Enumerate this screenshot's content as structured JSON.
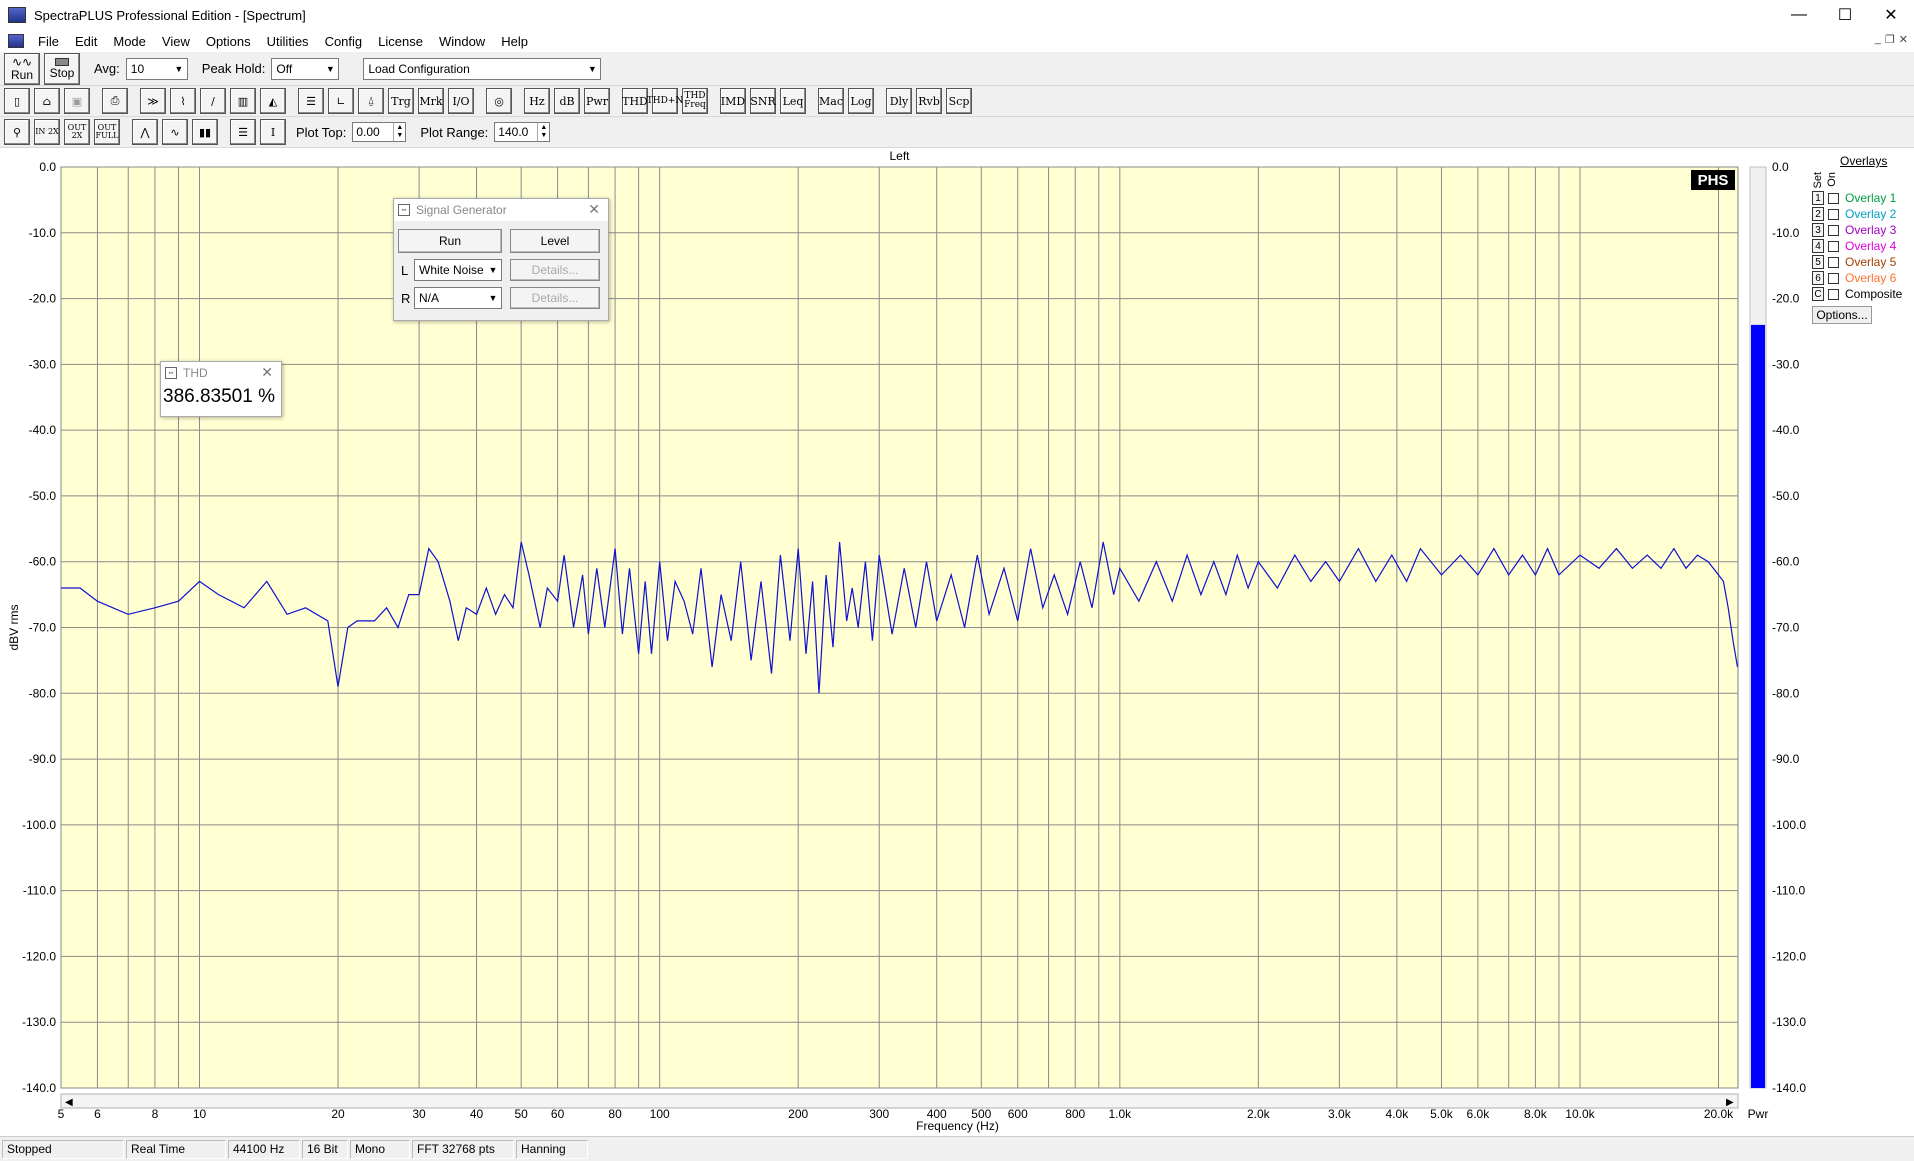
{
  "window": {
    "title": "SpectraPLUS Professional Edition - [Spectrum]",
    "buttons": [
      "—",
      "☐",
      "✕"
    ]
  },
  "menu": {
    "items": [
      "File",
      "Edit",
      "Mode",
      "View",
      "Options",
      "Utilities",
      "Config",
      "License",
      "Window",
      "Help"
    ],
    "mdi_buttons": [
      "_",
      "❐",
      "✕"
    ]
  },
  "toolbar1": {
    "run_label": "Run",
    "stop_label": "Stop",
    "avg_label": "Avg:",
    "avg_value": "10",
    "peak_label": "Peak Hold:",
    "peak_value": "Off",
    "config_value": "Load Configuration"
  },
  "toolbar2": {
    "buttons": [
      "Trg",
      "Mrk",
      "I/O",
      "Hz",
      "dB",
      "Pwr",
      "THD",
      "THD+N",
      "THD Freq",
      "IMD",
      "SNR",
      "Leq",
      "Mac",
      "Log",
      "Dly",
      "Rvb",
      "Scp"
    ]
  },
  "toolbar3": {
    "zoom_buttons": [
      "IN 2X",
      "OUT 2X",
      "OUT FULL"
    ],
    "plot_top_label": "Plot Top:",
    "plot_top_value": "0.00",
    "plot_range_label": "Plot Range:",
    "plot_range_value": "140.0"
  },
  "chart_data": {
    "type": "line",
    "title": "Left",
    "xlabel": "Frequency (Hz)",
    "ylabel": "dBV rms",
    "x_scale": "log",
    "xlim": [
      5,
      22050
    ],
    "ylim": [
      -140,
      0
    ],
    "x_tick_labels": [
      "5",
      "6",
      "8",
      "10",
      "20",
      "30",
      "40",
      "50",
      "60",
      "80",
      "100",
      "200",
      "300",
      "400",
      "500",
      "600",
      "800",
      "1.0k",
      "2.0k",
      "3.0k",
      "4.0k",
      "5.0k",
      "6.0k",
      "8.0k",
      "10.0k",
      "20.0k"
    ],
    "x_tick_values": [
      5,
      6,
      8,
      10,
      20,
      30,
      40,
      50,
      60,
      80,
      100,
      200,
      300,
      400,
      500,
      600,
      800,
      1000,
      2000,
      3000,
      4000,
      5000,
      6000,
      8000,
      10000,
      20000
    ],
    "y_tick_labels": [
      "0.0",
      "-10.0",
      "-20.0",
      "-30.0",
      "-40.0",
      "-50.0",
      "-60.0",
      "-70.0",
      "-80.0",
      "-90.0",
      "-100.0",
      "-110.0",
      "-120.0",
      "-130.0",
      "-140.0"
    ],
    "grid": true,
    "series": [
      {
        "color": "#1010d0",
        "x": [
          5,
          5.5,
          6,
          7,
          8,
          9,
          10,
          11,
          12.5,
          14,
          15.5,
          17,
          19,
          20,
          21,
          22,
          24,
          25.5,
          27,
          28.5,
          30,
          31.5,
          33,
          35,
          36.5,
          38,
          40,
          42,
          44,
          46,
          48,
          50,
          52,
          55,
          57,
          60,
          62,
          65,
          68,
          70,
          73,
          76,
          80,
          83,
          86,
          90,
          93,
          96,
          100,
          104,
          108,
          113,
          118,
          123,
          130,
          136,
          143,
          150,
          158,
          166,
          175,
          183,
          192,
          200,
          208,
          215,
          222,
          230,
          238,
          246,
          255,
          262,
          270,
          280,
          290,
          300,
          320,
          340,
          360,
          380,
          400,
          430,
          460,
          490,
          520,
          560,
          600,
          640,
          680,
          720,
          770,
          820,
          870,
          920,
          970,
          1000,
          1100,
          1200,
          1300,
          1400,
          1500,
          1600,
          1700,
          1800,
          1900,
          2000,
          2200,
          2400,
          2600,
          2800,
          3000,
          3300,
          3600,
          3900,
          4200,
          4500,
          5000,
          5500,
          6000,
          6500,
          7000,
          7500,
          8000,
          8500,
          9000,
          10000,
          11000,
          12000,
          13000,
          14000,
          15000,
          16000,
          17000,
          18000,
          19000,
          20000,
          20500,
          21000,
          21500,
          22000
        ],
        "y": [
          -64,
          -64,
          -66,
          -68,
          -67,
          -66,
          -63,
          -65,
          -67,
          -63,
          -68,
          -67,
          -69,
          -79,
          -70,
          -69,
          -69,
          -67,
          -70,
          -65,
          -65,
          -58,
          -60,
          -66,
          -72,
          -67,
          -68,
          -64,
          -68,
          -65,
          -67,
          -57,
          -62,
          -70,
          -64,
          -66,
          -59,
          -70,
          -62,
          -71,
          -61,
          -70,
          -58,
          -71,
          -61,
          -74,
          -63,
          -74,
          -60,
          -72,
          -63,
          -66,
          -71,
          -61,
          -76,
          -65,
          -72,
          -60,
          -75,
          -63,
          -77,
          -59,
          -72,
          -58,
          -74,
          -63,
          -80,
          -62,
          -73,
          -57,
          -69,
          -64,
          -70,
          -60,
          -72,
          -59,
          -71,
          -61,
          -70,
          -60,
          -69,
          -62,
          -70,
          -59,
          -68,
          -61,
          -69,
          -58,
          -67,
          -62,
          -68,
          -60,
          -67,
          -57,
          -65,
          -61,
          -66,
          -60,
          -66,
          -59,
          -65,
          -60,
          -65,
          -59,
          -64,
          -60,
          -64,
          -59,
          -63,
          -60,
          -63,
          -58,
          -63,
          -59,
          -63,
          -58,
          -62,
          -59,
          -62,
          -58,
          -62,
          -59,
          -62,
          -58,
          -62,
          -59,
          -61,
          -58,
          -61,
          -59,
          -61,
          -58,
          -61,
          -59,
          -60,
          -62,
          -63,
          -67,
          -72,
          -76
        ]
      }
    ]
  },
  "power_bar": {
    "label": "Pwr",
    "level_db": -24,
    "color": "#0000ff",
    "y_tick_labels": [
      "0.0",
      "-10.0",
      "-20.0",
      "-30.0",
      "-40.0",
      "-50.0",
      "-60.0",
      "-70.0",
      "-80.0",
      "-90.0",
      "-100.0",
      "-110.0",
      "-120.0",
      "-130.0",
      "-140.0"
    ]
  },
  "logo": "PHS",
  "overlays": {
    "header": "Overlays",
    "set_label": "Set",
    "on_label": "On",
    "items": [
      {
        "num": "1",
        "name": "Overlay 1",
        "color": "#00a040"
      },
      {
        "num": "2",
        "name": "Overlay 2",
        "color": "#00a0c0"
      },
      {
        "num": "3",
        "name": "Overlay 3",
        "color": "#a000c0"
      },
      {
        "num": "4",
        "name": "Overlay 4",
        "color": "#e000e0"
      },
      {
        "num": "5",
        "name": "Overlay 5",
        "color": "#a04000"
      },
      {
        "num": "6",
        "name": "Overlay 6",
        "color": "#ff7030"
      },
      {
        "num": "C",
        "name": "Composite",
        "color": "#000000"
      }
    ],
    "options_label": "Options..."
  },
  "signal_generator": {
    "title": "Signal Generator",
    "run_label": "Run",
    "level_label": "Level",
    "left_label": "L",
    "left_value": "White Noise",
    "right_label": "R",
    "right_value": "N/A",
    "details_label": "Details..."
  },
  "thd_window": {
    "title": "THD",
    "value": "386.83501 %"
  },
  "statusbar": {
    "cells": [
      "Stopped",
      "Real Time",
      "44100 Hz",
      "16 Bit",
      "Mono",
      "FFT 32768 pts",
      "Hanning"
    ]
  }
}
